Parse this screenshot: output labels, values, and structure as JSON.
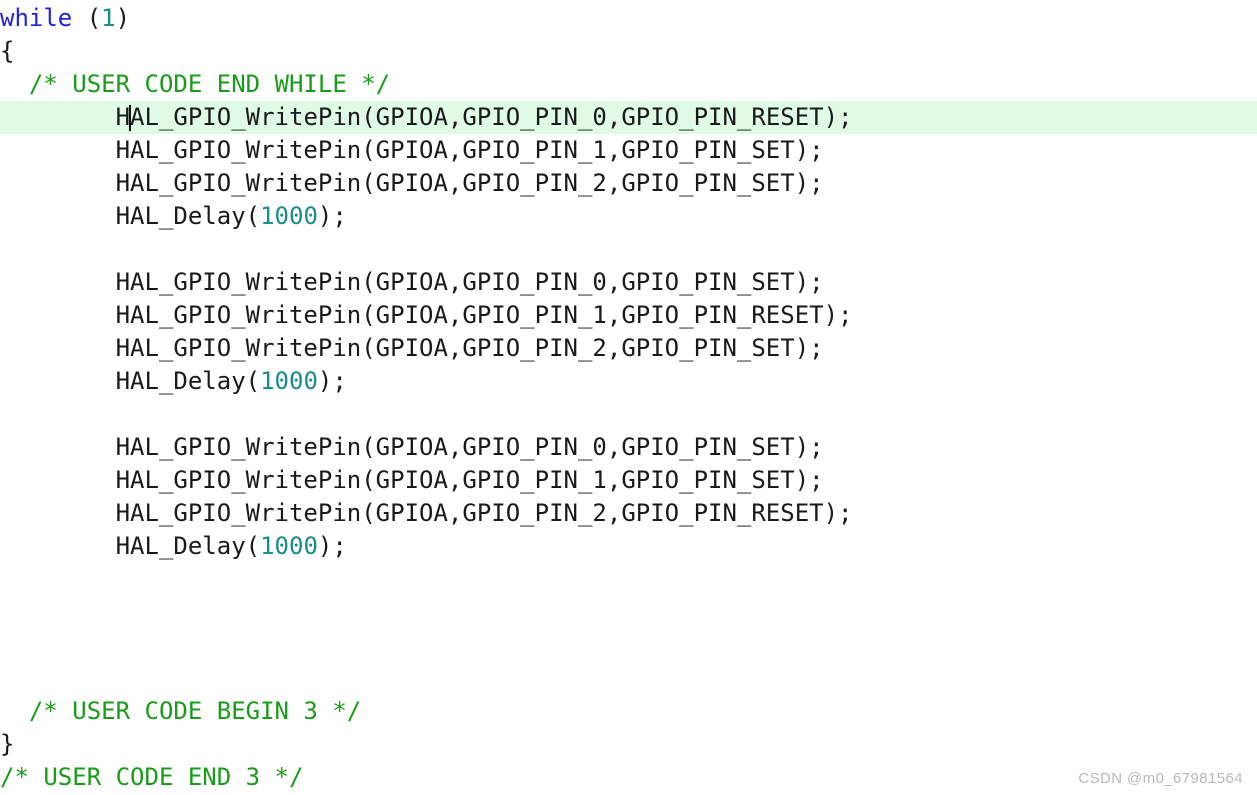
{
  "editor": {
    "language": "c",
    "highlight_line_index": 3,
    "cursor": {
      "line_index": 3,
      "column": 9,
      "after_text": "        H"
    },
    "colors": {
      "background": "#ffffff",
      "text": "#1a1a1a",
      "keyword": "#2222dd",
      "comment": "#1a9c1a",
      "number": "#1a8c8c",
      "line_highlight": "#e0fbe5",
      "caret": "#101010",
      "watermark": "#b9b9b9"
    },
    "lines": [
      {
        "index": 0,
        "highlight": false,
        "tokens": [
          {
            "type": "keyword",
            "text": "while"
          },
          {
            "type": "plain",
            "text": " ("
          },
          {
            "type": "number",
            "text": "1"
          },
          {
            "type": "plain",
            "text": ")"
          }
        ]
      },
      {
        "index": 1,
        "highlight": false,
        "tokens": [
          {
            "type": "plain",
            "text": "{"
          }
        ]
      },
      {
        "index": 2,
        "highlight": false,
        "tokens": [
          {
            "type": "comment",
            "text": "  /* USER CODE END WHILE */"
          }
        ]
      },
      {
        "index": 3,
        "highlight": true,
        "tokens": [
          {
            "type": "plain",
            "text": "        H"
          },
          {
            "type": "caret",
            "text": ""
          },
          {
            "type": "plain",
            "text": "AL_GPIO_WritePin(GPIOA,GPIO_PIN_0,GPIO_PIN_RESET);"
          }
        ]
      },
      {
        "index": 4,
        "highlight": false,
        "tokens": [
          {
            "type": "plain",
            "text": "        HAL_GPIO_WritePin(GPIOA,GPIO_PIN_1,GPIO_PIN_SET);"
          }
        ]
      },
      {
        "index": 5,
        "highlight": false,
        "tokens": [
          {
            "type": "plain",
            "text": "        HAL_GPIO_WritePin(GPIOA,GPIO_PIN_2,GPIO_PIN_SET);"
          }
        ]
      },
      {
        "index": 6,
        "highlight": false,
        "tokens": [
          {
            "type": "plain",
            "text": "        HAL_Delay("
          },
          {
            "type": "number",
            "text": "1000"
          },
          {
            "type": "plain",
            "text": ");"
          }
        ]
      },
      {
        "index": 7,
        "highlight": false,
        "tokens": [
          {
            "type": "plain",
            "text": ""
          }
        ]
      },
      {
        "index": 8,
        "highlight": false,
        "tokens": [
          {
            "type": "plain",
            "text": "        HAL_GPIO_WritePin(GPIOA,GPIO_PIN_0,GPIO_PIN_SET);"
          }
        ]
      },
      {
        "index": 9,
        "highlight": false,
        "tokens": [
          {
            "type": "plain",
            "text": "        HAL_GPIO_WritePin(GPIOA,GPIO_PIN_1,GPIO_PIN_RESET);"
          }
        ]
      },
      {
        "index": 10,
        "highlight": false,
        "tokens": [
          {
            "type": "plain",
            "text": "        HAL_GPIO_WritePin(GPIOA,GPIO_PIN_2,GPIO_PIN_SET);"
          }
        ]
      },
      {
        "index": 11,
        "highlight": false,
        "tokens": [
          {
            "type": "plain",
            "text": "        HAL_Delay("
          },
          {
            "type": "number",
            "text": "1000"
          },
          {
            "type": "plain",
            "text": ");"
          }
        ]
      },
      {
        "index": 12,
        "highlight": false,
        "tokens": [
          {
            "type": "plain",
            "text": ""
          }
        ]
      },
      {
        "index": 13,
        "highlight": false,
        "tokens": [
          {
            "type": "plain",
            "text": "        HAL_GPIO_WritePin(GPIOA,GPIO_PIN_0,GPIO_PIN_SET);"
          }
        ]
      },
      {
        "index": 14,
        "highlight": false,
        "tokens": [
          {
            "type": "plain",
            "text": "        HAL_GPIO_WritePin(GPIOA,GPIO_PIN_1,GPIO_PIN_SET);"
          }
        ]
      },
      {
        "index": 15,
        "highlight": false,
        "tokens": [
          {
            "type": "plain",
            "text": "        HAL_GPIO_WritePin(GPIOA,GPIO_PIN_2,GPIO_PIN_RESET);"
          }
        ]
      },
      {
        "index": 16,
        "highlight": false,
        "tokens": [
          {
            "type": "plain",
            "text": "        HAL_Delay("
          },
          {
            "type": "number",
            "text": "1000"
          },
          {
            "type": "plain",
            "text": ");"
          }
        ]
      },
      {
        "index": 17,
        "highlight": false,
        "tokens": [
          {
            "type": "plain",
            "text": ""
          }
        ]
      },
      {
        "index": 18,
        "highlight": false,
        "tokens": [
          {
            "type": "plain",
            "text": ""
          }
        ]
      },
      {
        "index": 19,
        "highlight": false,
        "tokens": [
          {
            "type": "plain",
            "text": ""
          }
        ]
      },
      {
        "index": 20,
        "highlight": false,
        "tokens": [
          {
            "type": "plain",
            "text": ""
          }
        ]
      },
      {
        "index": 21,
        "highlight": false,
        "tokens": [
          {
            "type": "comment",
            "text": "  /* USER CODE BEGIN 3 */"
          }
        ]
      },
      {
        "index": 22,
        "highlight": false,
        "tokens": [
          {
            "type": "plain",
            "text": "}"
          }
        ]
      },
      {
        "index": 23,
        "highlight": false,
        "tokens": [
          {
            "type": "comment",
            "text": "/* USER CODE END 3 */"
          }
        ]
      }
    ]
  },
  "watermark": {
    "text": "CSDN @m0_67981564"
  }
}
